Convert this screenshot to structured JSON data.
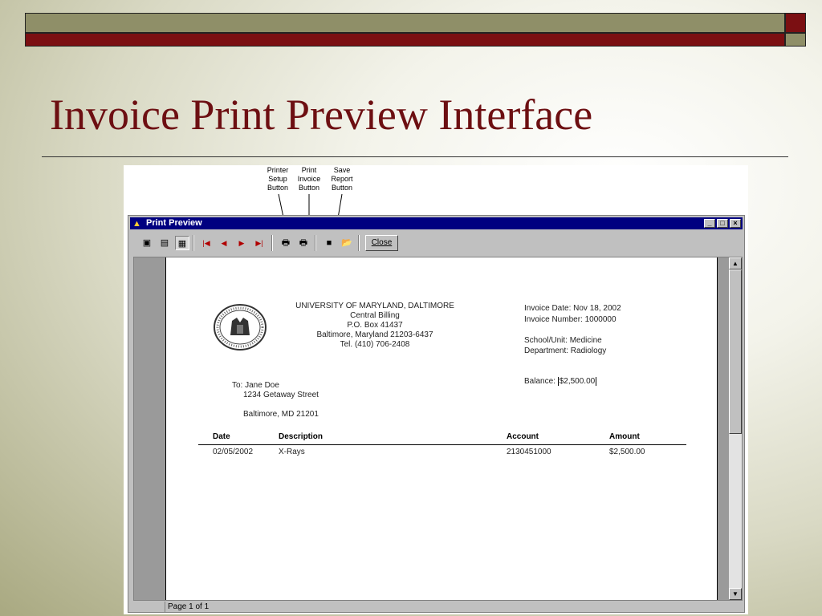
{
  "slide": {
    "title": "Invoice Print Preview Interface"
  },
  "callouts": [
    {
      "lines": [
        "Printer",
        "Setup",
        "Button"
      ]
    },
    {
      "lines": [
        "Print",
        "Invoice",
        "Button"
      ]
    },
    {
      "lines": [
        "Save",
        "Report",
        "Button"
      ]
    }
  ],
  "window": {
    "title": "Print Preview",
    "controls": {
      "minimize": "_",
      "maximize": "□",
      "close": "×"
    }
  },
  "toolbar": {
    "buttons": [
      {
        "name": "one-page-view",
        "icon": "single-page-icon",
        "glyph": "▣"
      },
      {
        "name": "page-width-view",
        "icon": "page-width-icon",
        "glyph": "▤"
      },
      {
        "name": "zoom-view",
        "icon": "zoom-page-icon",
        "glyph": "▦"
      },
      {
        "name": "first-page",
        "icon": "first-page-icon",
        "glyph": "|◀"
      },
      {
        "name": "previous-page",
        "icon": "previous-page-icon",
        "glyph": "◀"
      },
      {
        "name": "next-page",
        "icon": "next-page-icon",
        "glyph": "▶"
      },
      {
        "name": "last-page",
        "icon": "last-page-icon",
        "glyph": "▶|"
      },
      {
        "name": "printer-setup",
        "icon": "printer-setup-icon",
        "glyph": "🖶"
      },
      {
        "name": "print-invoice",
        "icon": "printer-icon",
        "glyph": "🖶"
      },
      {
        "name": "save-report",
        "icon": "floppy-disk-icon",
        "glyph": "■"
      },
      {
        "name": "open-report",
        "icon": "open-folder-icon",
        "glyph": "📂"
      }
    ],
    "close_label": "Close"
  },
  "invoice": {
    "org_lines": [
      "UNIVERSITY OF MARYLAND, DALTIMORE",
      "Central Billing",
      "P.O. Box 41437",
      "Baltimore, Maryland  21203-6437",
      "Tel. (410) 706-2408"
    ],
    "invoice_date": "Invoice Date: Nov 18, 2002",
    "invoice_number": "Invoice Number: 1000000",
    "school_unit": "School/Unit: Medicine",
    "department": "Department: Radiology",
    "balance_label": "Balance:",
    "balance_value": "$2,500.00",
    "to_lines": [
      "To: Jane Doe",
      "1234 Getaway Street"
    ],
    "city_line": "Baltimore, MD  21201",
    "columns": [
      "Date",
      "Description",
      "Account",
      "Amount"
    ],
    "rows": [
      {
        "date": "02/05/2002",
        "description": "X-Rays",
        "account": "2130451000",
        "amount": "$2,500.00"
      }
    ]
  },
  "status": {
    "page": "Page 1 of 1"
  },
  "colors": {
    "accent_red": "#7b0f12",
    "olive": "#8f8f68",
    "titlebar": "#000080"
  }
}
